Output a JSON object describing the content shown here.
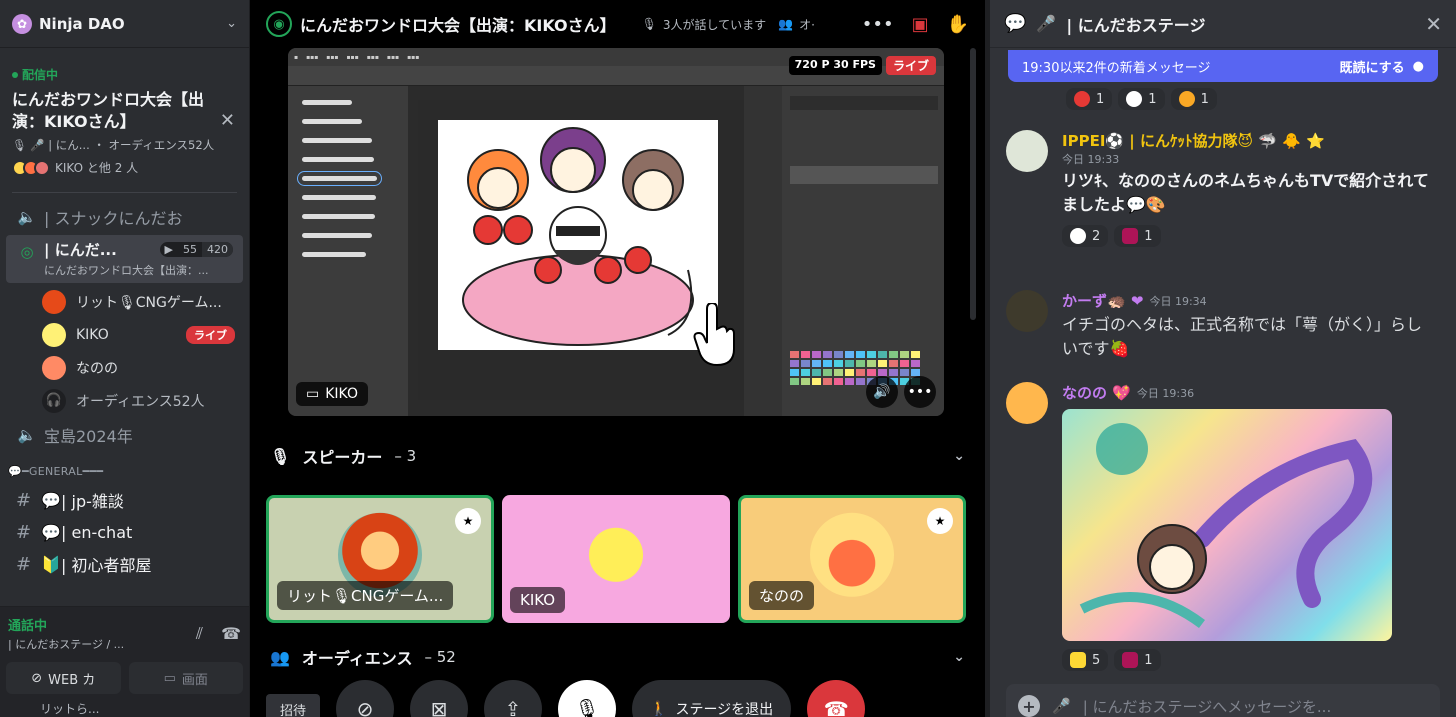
{
  "server": {
    "name": "Ninja DAO"
  },
  "event": {
    "status": "配信中",
    "title": "にんだおワンドロ大会【出演：KIKOさん】",
    "sub": "| にん... ・ オーディエンス52人",
    "people": "KIKO と他 2 人"
  },
  "channels": {
    "snack": "| スナックにんだお",
    "stage_name": "| にんだ...",
    "stage_sub": "にんだおワンドロ大会【出演：...",
    "video_count": "55",
    "listen_count": "420",
    "takara": "宝島2024年"
  },
  "stage_users": [
    {
      "name": "リット🎙CNGゲーム...",
      "live": ""
    },
    {
      "name": "KIKO",
      "live": "ライブ"
    },
    {
      "name": "なのの",
      "live": ""
    },
    {
      "name": "オーディエンス52人",
      "live": ""
    }
  ],
  "category": "💬━GENERAL━━━",
  "text_channels": [
    {
      "name": "| jp-雑談"
    },
    {
      "name": "| en-chat"
    },
    {
      "name": "| 初心者部屋"
    }
  ],
  "voice_panel": {
    "status": "通話中",
    "sub": "| にんだおステージ / ...",
    "camera_label": "WEB カ",
    "screen_label": "画面",
    "bottom_user": "リットら..."
  },
  "stage": {
    "title": "にんだおワンドロ大会【出演：KIKOさん】",
    "speaking": "3人が話しています",
    "audience_short": "オ·",
    "video": {
      "quality": "720 P 30 FPS",
      "live": "ライブ",
      "streamer": "KIKO"
    },
    "speakers_label": "スピーカー",
    "speakers_count": "– 3",
    "speakers": [
      {
        "name": "リット🎙CNGゲーム...",
        "mod": true
      },
      {
        "name": "KIKO",
        "mod": false
      },
      {
        "name": "なのの",
        "mod": true
      }
    ],
    "audience_label": "オーディエンス",
    "audience_count": "– 52",
    "invite": "招待",
    "leave": "ステージを退出"
  },
  "chat": {
    "title": "| にんだおステージ",
    "new_messages": "19:30以来2件の新着メッセージ",
    "mark_read": "既読にする",
    "top_reactions": [
      {
        "emoji": "strawberry",
        "count": "1",
        "color": "#e53935"
      },
      {
        "emoji": "eyes",
        "count": "1",
        "color": "#ffffff"
      },
      {
        "emoji": "rofl",
        "count": "1",
        "color": "#f9a825"
      }
    ],
    "messages": [
      {
        "author": "IPPEI⚽ | にんｹｯﾄ協力隊😈 🦈 🐥 ⭐",
        "author_color": "#f1c40f",
        "time": "今日 19:33",
        "text": "リツｷ、なののさんのネムちゃんもTVで紹介されてましたよ💬🎨",
        "reactions": [
          {
            "emoji": "eyes",
            "count": "2",
            "color": "#ffffff"
          },
          {
            "emoji": "ninja",
            "count": "1",
            "color": "#ad1457"
          }
        ]
      },
      {
        "author": "かーず🦔 ❤",
        "author_color": "#c27cf0",
        "time": "今日 19:34",
        "text": "イチゴのヘタは、正式名称では「萼（がく）」らしいです🍓",
        "reactions": []
      },
      {
        "author": "なのの 💖",
        "author_color": "#c27cf0",
        "time": "今日 19:36",
        "text": "",
        "reactions": [
          {
            "emoji": "sparkles",
            "count": "5",
            "color": "#fdd835"
          },
          {
            "emoji": "ninja",
            "count": "1",
            "color": "#ad1457"
          }
        ]
      }
    ],
    "input_placeholder": "| にんだおステージへメッセージを..."
  }
}
